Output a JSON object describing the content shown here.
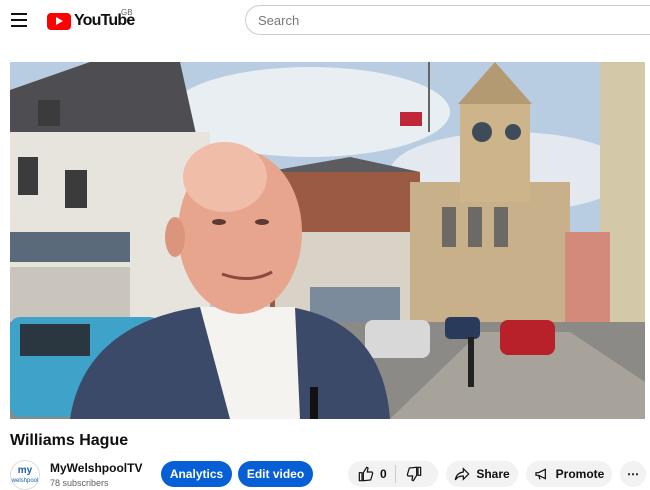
{
  "header": {
    "logo_text": "YouTube",
    "region": "GB",
    "search_placeholder": "Search"
  },
  "video": {
    "title": "Williams Hague"
  },
  "channel": {
    "name": "MyWelshpoolTV",
    "subscribers": "78 subscribers",
    "avatar_text": "my",
    "avatar_subtext": "welshpool"
  },
  "actions": {
    "analytics": "Analytics",
    "edit_video": "Edit video",
    "likes": "0",
    "share": "Share",
    "promote": "Promote",
    "more": "⋯"
  },
  "icons": [
    "menu-icon",
    "youtube-logo-icon",
    "like-icon",
    "dislike-icon",
    "share-icon",
    "promote-icon",
    "more-icon"
  ]
}
